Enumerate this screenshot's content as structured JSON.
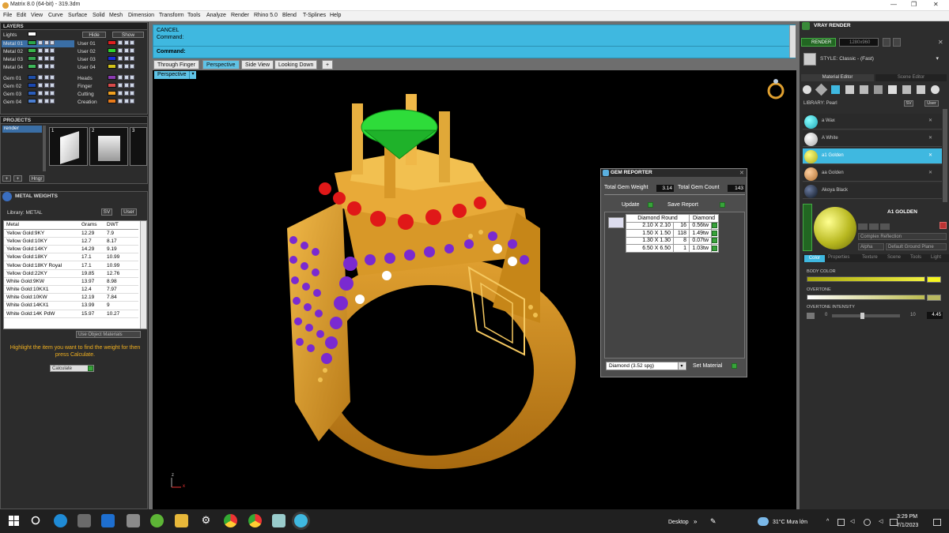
{
  "window": {
    "title": "Matrix 8.0 (64-bit) - 319.3dm",
    "controls": [
      "—",
      "❐",
      "✕"
    ]
  },
  "menu": [
    "File",
    "Edit",
    "View",
    "Curve",
    "Surface",
    "Solid",
    "Mesh",
    "Dimension",
    "Transform",
    "Tools",
    "Analyze",
    "Render",
    "Rhino 5.0",
    "Blend",
    "T-Splines",
    "Help"
  ],
  "layers": {
    "title": "LAYERS",
    "lights": "Lights",
    "hide": "Hide",
    "show": "Show",
    "left": [
      {
        "name": "Metal 01",
        "color": "#2ca84a"
      },
      {
        "name": "Metal 02",
        "color": "#38b34a"
      },
      {
        "name": "Metal 03",
        "color": "#35a44f"
      },
      {
        "name": "Metal 04",
        "color": "#3eb85a"
      },
      {
        "name": "Gem 01",
        "color": "#1f4fa8"
      },
      {
        "name": "Gem 02",
        "color": "#1a48b0"
      },
      {
        "name": "Gem 03",
        "color": "#2a5dbb"
      },
      {
        "name": "Gem 04",
        "color": "#4a7ed0"
      }
    ],
    "right": [
      {
        "name": "User 01",
        "color": "#e02020"
      },
      {
        "name": "User 02",
        "color": "#2fd02f"
      },
      {
        "name": "User 03",
        "color": "#1a2ad8"
      },
      {
        "name": "User 04",
        "color": "#d2c21a"
      },
      {
        "name": "Heads",
        "color": "#8a3ab0"
      },
      {
        "name": "Finger",
        "color": "#d84a4a"
      },
      {
        "name": "Cutting",
        "color": "#f0a020"
      },
      {
        "name": "Creation",
        "color": "#e87a1a"
      }
    ]
  },
  "projects": {
    "title": "PROJECTS",
    "item": "render",
    "thumbs": [
      "1",
      "2",
      "3"
    ],
    "hinge": "Hngr"
  },
  "metal": {
    "title": "METAL WEIGHTS",
    "library_label": "Library: METAL",
    "library_mode": "SV",
    "user": "User",
    "columns": [
      "Metal",
      "Grams",
      "DWT"
    ],
    "rows": [
      [
        "Yellow Gold:9KY",
        "12.29",
        "7.9"
      ],
      [
        "Yellow Gold:10KY",
        "12.7",
        "8.17"
      ],
      [
        "Yellow Gold:14KY",
        "14.29",
        "9.19"
      ],
      [
        "Yellow Gold:18KY",
        "17.1",
        "10.99"
      ],
      [
        "Yellow Gold:18KY Royal",
        "17.1",
        "10.99"
      ],
      [
        "Yellow Gold:22KY",
        "19.85",
        "12.76"
      ],
      [
        "White Gold:9KW",
        "13.97",
        "8.98"
      ],
      [
        "White Gold:10KX1",
        "12.4",
        "7.97"
      ],
      [
        "White Gold:10KW",
        "12.19",
        "7.84"
      ],
      [
        "White Gold:14KX1",
        "13.99",
        "9"
      ],
      [
        "White Gold:14K PdW",
        "15.97",
        "10.27"
      ]
    ],
    "use_object": "Use Object Materials",
    "hint": "Highlight the item you want to find the weight for then press Calculate.",
    "calculate": "Calculate"
  },
  "command": {
    "cancel": "CANCEL",
    "line2": "Command:",
    "prompt": "Command:"
  },
  "view_tabs": [
    "Through Finger",
    "Perspective",
    "Side View",
    "Looking Down",
    "+"
  ],
  "viewport": {
    "label": "Perspective",
    "axis_z": "z",
    "axis_x": "x"
  },
  "gem_reporter": {
    "title": "GEM REPORTER",
    "weight_label": "Total Gem Weight",
    "weight": "3.14",
    "count_label": "Total Gem Count",
    "count": "143",
    "update": "Update",
    "save": "Save Report",
    "columns": [
      "Diamond Round",
      "Diamond"
    ],
    "rows": [
      [
        "2.10 X 2.10",
        "16",
        "0.56tw"
      ],
      [
        "1.50 X 1.50",
        "118",
        "1.49tw"
      ],
      [
        "1.30 X 1.30",
        "8",
        "0.07tw"
      ],
      [
        "6.50 X 6.50",
        "1",
        "1.03tw"
      ]
    ],
    "material": "Diamond    (3.52 spg)",
    "set_material": "Set Material"
  },
  "vray": {
    "title": "VRAY RENDER",
    "render": "RENDER",
    "resolution": "1280x960",
    "style_label": "STYLE:",
    "style": "Classic - (Fast)",
    "tabs": [
      "Material Editor",
      "Scene Editor"
    ],
    "library": "LIBRARY: Pearl",
    "materials": [
      {
        "name": "a Wax",
        "color": "#1fa8b8"
      },
      {
        "name": "A White",
        "color": "#dcdcdc"
      },
      {
        "name": "a1 Golden",
        "color": "#c8c82a"
      },
      {
        "name": "aa Golden",
        "color": "#d89a5a"
      },
      {
        "name": "Akoya Black",
        "color": "#1c2a3e"
      }
    ],
    "selected": "A1 GOLDEN",
    "reflection": "Complex Reflection",
    "alpha": "Alpha",
    "ground": "Default Ground Plane",
    "subtabs": [
      "Color",
      "Properties",
      "Texture",
      "Scene",
      "Tools",
      "Light"
    ],
    "body_color": "BODY COLOR",
    "overtone": "OVERTONE",
    "intensity_label": "OVERTONE INTENSITY",
    "intensity_min": "0",
    "intensity_max": "10",
    "intensity": "4.45"
  },
  "taskbar": {
    "desktop": "Desktop",
    "weather": "31°C  Mưa lớn",
    "time": "3:29 PM",
    "date": "7/1/2023"
  },
  "colors": {
    "gold": "#d99a2a",
    "ruby": "#e01818",
    "amethyst": "#7a2ad0",
    "emerald": "#2edc3a",
    "accent": "#3fb8e0"
  }
}
